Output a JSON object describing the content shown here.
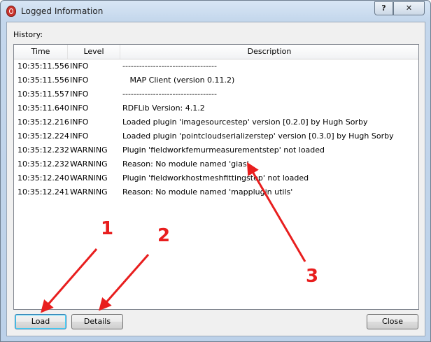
{
  "window": {
    "title": "Logged Information",
    "help_label": "?",
    "close_label": "✕"
  },
  "history": {
    "label": "History:"
  },
  "table": {
    "columns": [
      "Time",
      "Level",
      "Description"
    ],
    "rows": [
      {
        "time": "10:35:11.556",
        "level": "INFO",
        "description": "----------------------------------"
      },
      {
        "time": "10:35:11.556",
        "level": "INFO",
        "description": "   MAP Client (version 0.11.2)"
      },
      {
        "time": "10:35:11.557",
        "level": "INFO",
        "description": "----------------------------------"
      },
      {
        "time": "10:35:11.640",
        "level": "INFO",
        "description": "RDFLib Version: 4.1.2"
      },
      {
        "time": "10:35:12.216",
        "level": "INFO",
        "description": "Loaded plugin 'imagesourcestep' version [0.2.0] by Hugh Sorby"
      },
      {
        "time": "10:35:12.224",
        "level": "INFO",
        "description": "Loaded plugin 'pointcloudserializerstep' version [0.3.0] by Hugh Sorby"
      },
      {
        "time": "10:35:12.232",
        "level": "WARNING",
        "description": "Plugin 'fieldworkfemurmeasurementstep' not loaded"
      },
      {
        "time": "10:35:12.232",
        "level": "WARNING",
        "description": "Reason: No module named 'gias'"
      },
      {
        "time": "10:35:12.240",
        "level": "WARNING",
        "description": "Plugin 'fieldworkhostmeshfittingstep' not loaded"
      },
      {
        "time": "10:35:12.241",
        "level": "WARNING",
        "description": "Reason: No module named 'mapplugin utils'"
      }
    ]
  },
  "buttons": {
    "load": "Load",
    "details": "Details",
    "close": "Close"
  },
  "annotations": {
    "color": "#e81e1e",
    "labels": [
      "1",
      "2",
      "3"
    ]
  }
}
